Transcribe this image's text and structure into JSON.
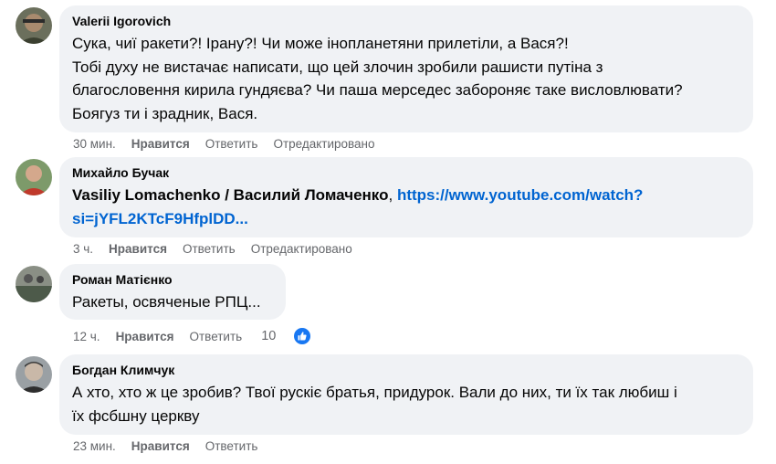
{
  "comments": [
    {
      "author": "Valerii Igorovich",
      "text": "Сука, чиї ракети?! Ірану?! Чи може інопланетяни прилетіли, а Вася?!\nТобі духу не вистачає написати, що цей злочин зробили рашисти путіна з\nблагословення кирила гундяєва? Чи паша мерседес забороняє таке висловлювати?\nБоягуз ти і зрадник, Вася.",
      "time": "30 мин.",
      "like": "Нравится",
      "reply": "Ответить",
      "edited": "Отредактировано"
    },
    {
      "author": "Михайло Бучак",
      "mention": "Vasiliy Lomachenko / Василий Ломаченко",
      "separator": ", ",
      "link_line1": "https://www.youtube.com/watch?",
      "link_line2": "si=jYFL2KTcF9HfplDD...",
      "time": "3 ч.",
      "like": "Нравится",
      "reply": "Ответить",
      "edited": "Отредактировано"
    },
    {
      "author": "Роман Матієнко",
      "text": "Ракеты, освяченые РПЦ...",
      "time": "12 ч.",
      "like": "Нравится",
      "reply": "Ответить",
      "reaction_count": "10",
      "reaction_icon": "thumbs-up-icon",
      "reaction_color": "#1877f2"
    },
    {
      "author": "Богдан Климчук",
      "text": "А хто, хто ж це зробив? Твої рускіє братья, придурок. Вали до них, ти їх так любиш і\nїх фсбшну церкву",
      "time": "23 мин.",
      "like": "Нравится",
      "reply": "Ответить"
    }
  ],
  "colors": {
    "bubble": "#f0f2f5",
    "link": "#0064d1",
    "meta": "#65676b"
  }
}
